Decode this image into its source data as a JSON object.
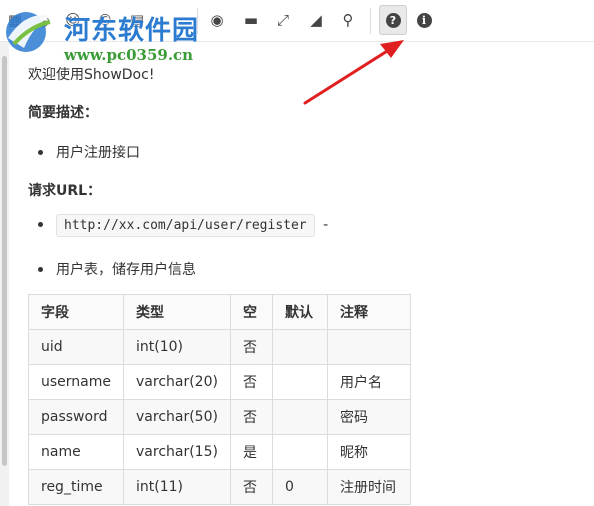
{
  "watermark": {
    "title": "河东软件园",
    "url": "www.pc0359.cn"
  },
  "toolbar": {
    "buttons": [
      {
        "name": "table-icon",
        "glyph": "▦"
      },
      {
        "name": "clock-icon",
        "glyph": "◷"
      },
      {
        "name": "emoji-icon",
        "glyph": "☺"
      },
      {
        "name": "copyright-icon",
        "glyph": "©"
      },
      {
        "name": "file-icon",
        "glyph": "▤"
      },
      {
        "name": "eye-slash-icon",
        "glyph": "◉"
      },
      {
        "name": "desktop-icon",
        "glyph": "▬"
      },
      {
        "name": "fullscreen-icon",
        "glyph": "⤢"
      },
      {
        "name": "eraser-icon",
        "glyph": "◢"
      },
      {
        "name": "search-icon",
        "glyph": "⚲"
      },
      {
        "name": "help-icon",
        "glyph": "?"
      },
      {
        "name": "info-icon",
        "glyph": "i"
      }
    ]
  },
  "content": {
    "welcome": "欢迎使用ShowDoc!",
    "brief_heading": "简要描述：",
    "brief_item": "用户注册接口",
    "url_heading": "请求URL：",
    "url_code": "http://xx.com/api/user/register",
    "url_suffix": "-",
    "table_note": "用户表，储存用户信息"
  },
  "table": {
    "headers": [
      "字段",
      "类型",
      "空",
      "默认",
      "注释"
    ],
    "rows": [
      [
        "uid",
        "int(10)",
        "否",
        "",
        ""
      ],
      [
        "username",
        "varchar(20)",
        "否",
        "",
        "用户名"
      ],
      [
        "password",
        "varchar(50)",
        "否",
        "",
        "密码"
      ],
      [
        "name",
        "varchar(15)",
        "是",
        "",
        "昵称"
      ],
      [
        "reg_time",
        "int(11)",
        "否",
        "0",
        "注册时间"
      ]
    ]
  },
  "colors": {
    "arrow": "#e02020",
    "watermark_blue": "#2b7bd1",
    "watermark_green": "#3a9c36"
  }
}
